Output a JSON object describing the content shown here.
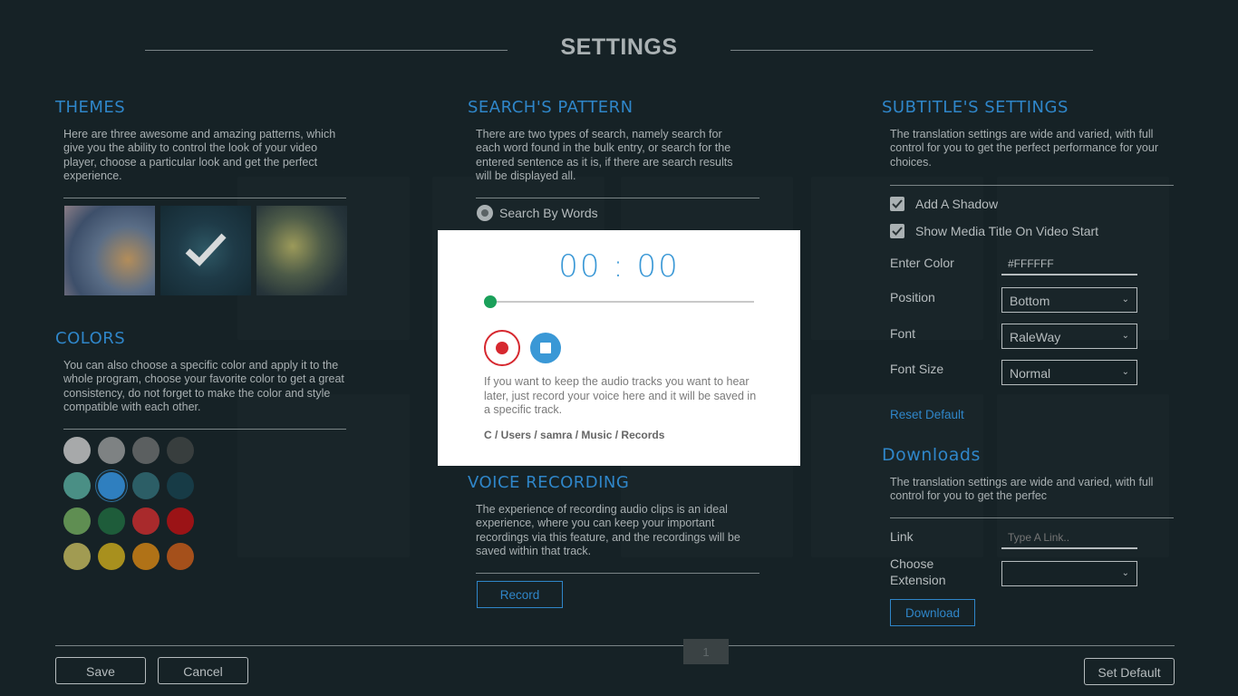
{
  "header": {
    "title": "SETTINGS"
  },
  "themes": {
    "title": "THEMES",
    "description": "Here are three awesome and amazing patterns, which give you the ability to control the look of your video player, choose a particular look and get the perfect experience.",
    "tiles": [
      "Theme 1",
      "Theme 2",
      "Theme 3"
    ],
    "selected_index": 1
  },
  "colors": {
    "title": "COLORS",
    "description": "You can also choose a specific color and apply it to the whole program, choose your favorite color to get a great consistency, do not forget to make the color and style compatible with each other.",
    "swatches": [
      "#a7a9aa",
      "#7e8283",
      "#5b5f60",
      "#383e3e",
      "#4a8f85",
      "#2f7fbf",
      "#2c5e66",
      "#173b46",
      "#5f8e52",
      "#1e5c3a",
      "#a92a2c",
      "#9b1316",
      "#a19b52",
      "#a8901e",
      "#b07217",
      "#a5501b"
    ],
    "selected_index": 5
  },
  "search": {
    "title": "SEARCH'S PATTERN",
    "description": "There are two types of search, namely search for each word found in the bulk entry, or search for the entered sentence as it is, if there are search results will be displayed all.",
    "option_words": "Search By Words"
  },
  "voice": {
    "title": "VOICE RECORDING",
    "description": "The experience of recording audio clips is an ideal experience, where you can keep your important recordings via this feature, and the recordings will be saved within that track.",
    "record_label": "Record"
  },
  "subtitles": {
    "title": "SUBTITLE'S SETTINGS",
    "description": "The translation settings are wide and varied, with full control for you to get the perfect performance for your choices.",
    "add_shadow": "Add A Shadow",
    "show_title": "Show Media Title On Video Start",
    "enter_color_label": "Enter Color",
    "enter_color_value": "#FFFFFF",
    "position_label": "Position",
    "position_value": "Bottom",
    "font_label": "Font",
    "font_value": "RaleWay",
    "font_size_label": "Font Size",
    "font_size_value": "Normal",
    "reset_label": "Reset Default"
  },
  "downloads": {
    "title": "Downloads",
    "description": "The translation settings are wide and varied, with full control for you to get the perfec",
    "link_label": "Link",
    "link_placeholder": "Type A Link..",
    "extension_label_1": "Choose",
    "extension_label_2": "Extension",
    "download_label": "Download"
  },
  "footer": {
    "save_label": "Save",
    "cancel_label": "Cancel",
    "set_default_label": "Set Default",
    "page_number": "1"
  },
  "modal": {
    "timer": "00 : 00",
    "progress": 0,
    "text": "If you want to keep the audio tracks you want to hear later, just record your voice here and it will be saved in a specific track.",
    "path": "C / Users / samra / Music / Records"
  },
  "colors_theme": {
    "accent": "#2f86c9",
    "record_red": "#d6282f",
    "progress_green": "#1aa05a"
  }
}
